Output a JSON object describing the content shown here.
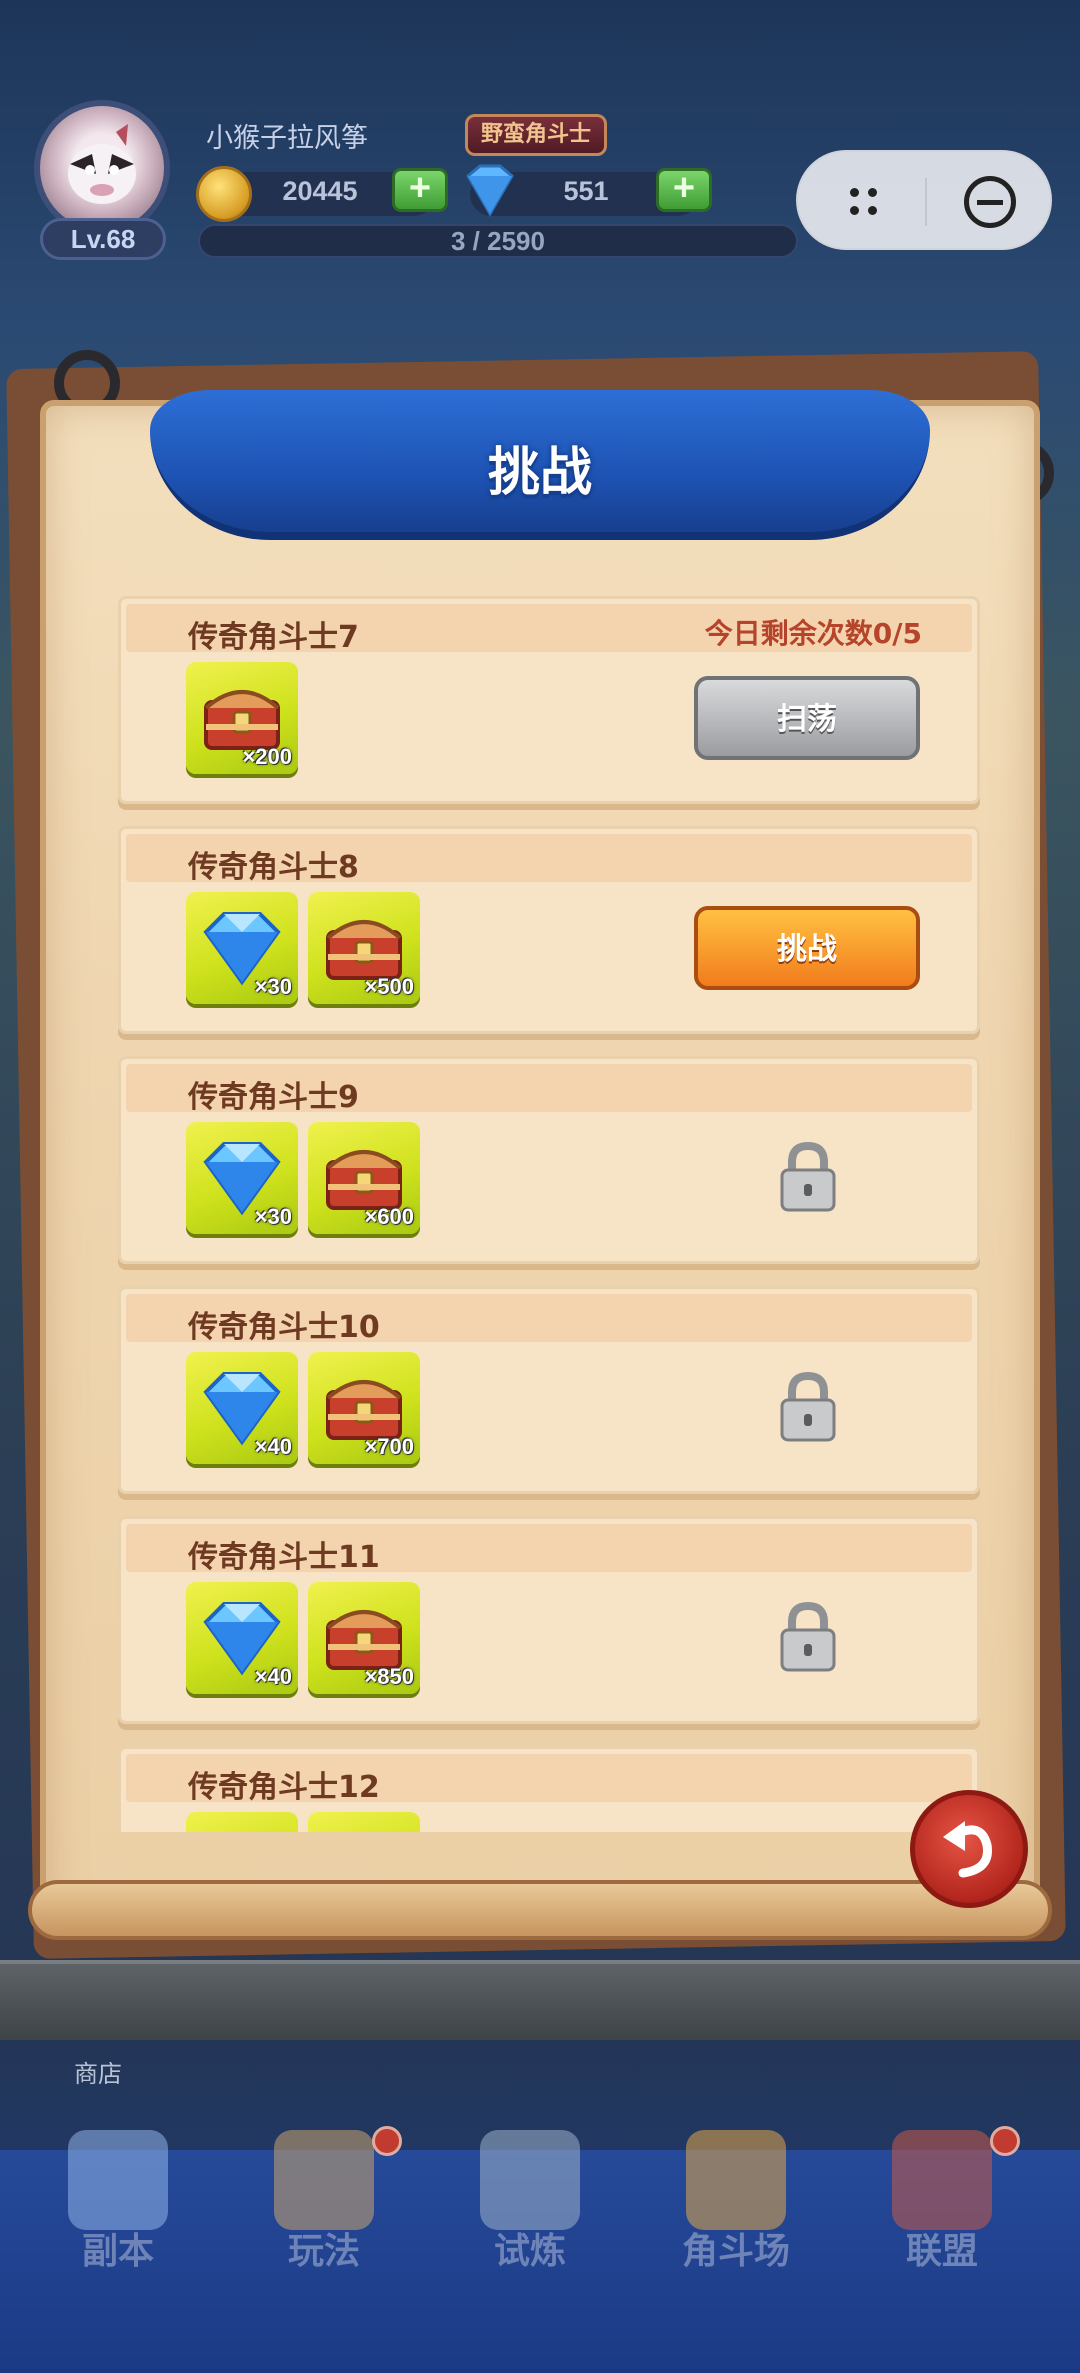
{
  "player": {
    "name": "小猴子拉风筝",
    "level": "Lv.68",
    "title": "野蛮角斗士",
    "coins": "20445",
    "gems": "551",
    "exp": "3 / 2590"
  },
  "panel": {
    "title": "挑战"
  },
  "levels": [
    {
      "name": "传奇角斗士7",
      "remaining": "今日剩余次数0/5",
      "rewards": [
        {
          "icon": "chest-icon",
          "qty": "×200"
        }
      ],
      "action": "扫荡",
      "state": "sweep"
    },
    {
      "name": "传奇角斗士8",
      "remaining": "",
      "rewards": [
        {
          "icon": "diamond-icon",
          "qty": "×30"
        },
        {
          "icon": "chest-icon",
          "qty": "×500"
        }
      ],
      "action": "挑战",
      "state": "challenge"
    },
    {
      "name": "传奇角斗士9",
      "remaining": "",
      "rewards": [
        {
          "icon": "diamond-icon",
          "qty": "×30"
        },
        {
          "icon": "chest-icon",
          "qty": "×600"
        }
      ],
      "action": "",
      "state": "locked"
    },
    {
      "name": "传奇角斗士10",
      "remaining": "",
      "rewards": [
        {
          "icon": "diamond-icon",
          "qty": "×40"
        },
        {
          "icon": "chest-icon",
          "qty": "×700"
        }
      ],
      "action": "",
      "state": "locked"
    },
    {
      "name": "传奇角斗士11",
      "remaining": "",
      "rewards": [
        {
          "icon": "diamond-icon",
          "qty": "×40"
        },
        {
          "icon": "chest-icon",
          "qty": "×850"
        }
      ],
      "action": "",
      "state": "locked"
    },
    {
      "name": "传奇角斗士12",
      "remaining": "",
      "rewards": [
        {
          "icon": "diamond-icon",
          "qty": ""
        },
        {
          "icon": "chest-icon",
          "qty": ""
        }
      ],
      "action": "",
      "state": "locked"
    }
  ],
  "shop_label": "商店",
  "nav": [
    {
      "label": "副本",
      "icon": "dungeon-icon",
      "badge": false
    },
    {
      "label": "玩法",
      "icon": "gameplay-icon",
      "badge": true
    },
    {
      "label": "试炼",
      "icon": "crossed-swords-icon",
      "badge": false
    },
    {
      "label": "角斗场",
      "icon": "arena-shield-icon",
      "badge": false
    },
    {
      "label": "联盟",
      "icon": "alliance-banner-icon",
      "badge": true
    }
  ],
  "colors": {
    "banner": "#1e53b4",
    "challenge_button": "#f27c1d",
    "sweep_button": "#9a9ca0",
    "reward_bg": "#cfe21d",
    "name_text": "#6e3a21",
    "count_text": "#b5442a"
  }
}
